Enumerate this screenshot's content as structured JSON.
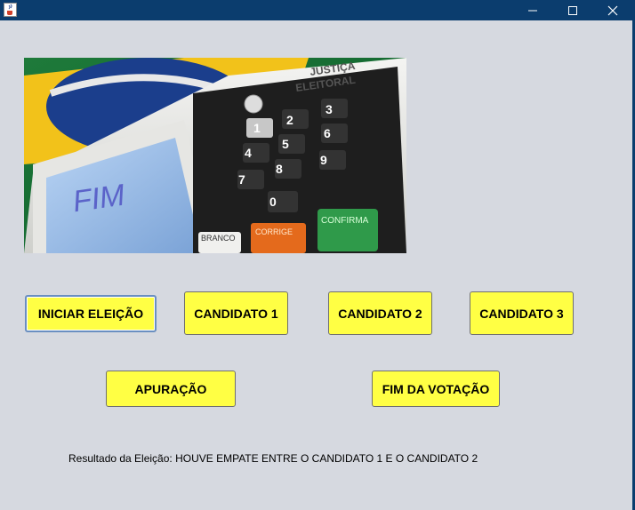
{
  "window": {
    "app_icon": "java-cup-icon",
    "controls": [
      "minimize-icon",
      "maximize-icon",
      "close-icon"
    ]
  },
  "banner": {
    "screen_text": "FIM",
    "header_text_line1": "JUSTIÇA",
    "header_text_line2": "ELEITORAL",
    "keys": [
      "1",
      "2",
      "3",
      "4",
      "5",
      "6",
      "7",
      "8",
      "9",
      "0"
    ],
    "key_branco": "BRANCO",
    "key_corrige": "CORRIGE",
    "key_confirma": "CONFIRMA"
  },
  "buttons": {
    "iniciar": "INICIAR ELEIÇÃO",
    "candidato1": "CANDIDATO 1",
    "candidato2": "CANDIDATO 2",
    "candidato3": "CANDIDATO 3",
    "apuracao": "APURAÇÃO",
    "fim_votacao": "FIM DA VOTAÇÃO"
  },
  "result": {
    "text": "Resultado da Eleição: HOUVE EMPATE ENTRE O CANDIDATO 1 E O CANDIDATO 2"
  },
  "colors": {
    "title_bar": "#0b3d6e",
    "background": "#d6d9e0",
    "button": "#ffff44"
  }
}
